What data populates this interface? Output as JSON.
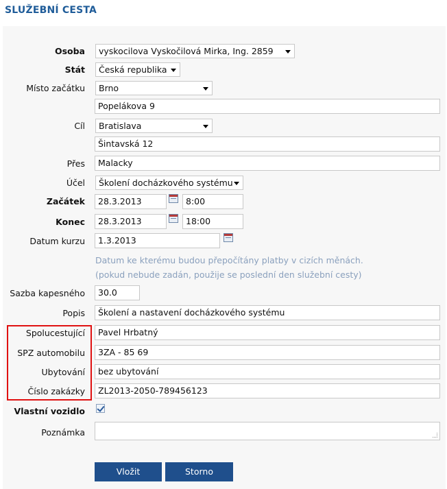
{
  "title": "SLUŽEBNÍ CESTA",
  "fields": {
    "osoba": {
      "label": "Osoba",
      "value": "vyskocilova Vyskočilová Mirka, Ing. 2859"
    },
    "stat": {
      "label": "Stát",
      "value": "Česká republika"
    },
    "misto_zacatku": {
      "label": "Místo začátku",
      "value": "Brno",
      "address": "Popelákova 9"
    },
    "cil": {
      "label": "Cíl",
      "value": "Bratislava",
      "address": "Šintavská 12"
    },
    "pres": {
      "label": "Přes",
      "value": "Malacky"
    },
    "ucel": {
      "label": "Účel",
      "value": "Školení docházkového systému"
    },
    "zacatek": {
      "label": "Začátek",
      "date": "28.3.2013",
      "time": "8:00"
    },
    "konec": {
      "label": "Konec",
      "date": "28.3.2013",
      "time": "18:00"
    },
    "datum_kurzu": {
      "label": "Datum kurzu",
      "value": "1.3.2013",
      "hint_line1": "Datum ke kterému budou přepočítány platby v cizích měnách.",
      "hint_line2": "(pokud nebude zadán, použije se poslední den služební cesty)"
    },
    "sazba_kapesneho": {
      "label": "Sazba kapesného",
      "value": "30.0"
    },
    "popis": {
      "label": "Popis",
      "value": "Školení a nastavení docházkového systému"
    },
    "spolucestujici": {
      "label": "Spolucestující",
      "value": "Pavel Hrbatný"
    },
    "spz_automobilu": {
      "label": "SPZ automobilu",
      "value": "3ZA - 85 69"
    },
    "ubytovani": {
      "label": "Ubytování",
      "value": "bez ubytování"
    },
    "cislo_zakazky": {
      "label": "Číslo zakázky",
      "value": "ZL2013-2050-789456123"
    },
    "vlastni_vozidlo": {
      "label": "Vlastní vozidlo",
      "checked": true
    },
    "poznamka": {
      "label": "Poznámka",
      "value": ""
    }
  },
  "buttons": {
    "submit": "Vložit",
    "cancel": "Storno"
  },
  "colors": {
    "title": "#1f5c99",
    "button": "#1f4f8c",
    "highlight_box": "#e01010",
    "hint": "#8aa0bd"
  }
}
